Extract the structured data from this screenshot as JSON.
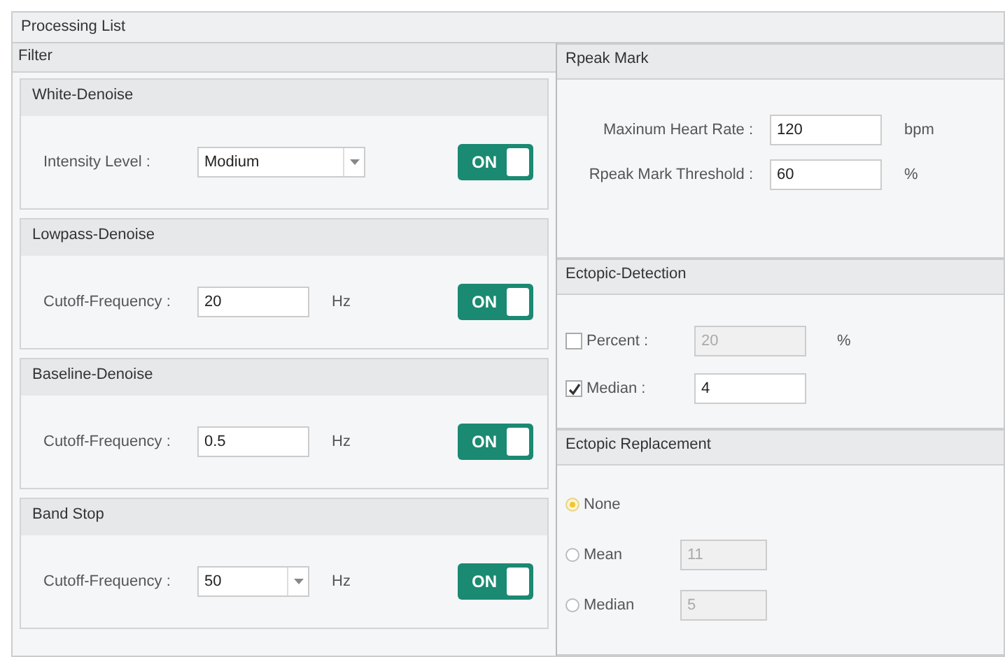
{
  "window": {
    "title": "Processing List"
  },
  "filter": {
    "title": "Filter",
    "sections": [
      {
        "title": "White-Denoise",
        "kind": "select",
        "label": "Intensity Level :",
        "value": "Modium",
        "switch": {
          "label": "ON",
          "on": true
        }
      },
      {
        "title": "Lowpass-Denoise",
        "kind": "input",
        "label": "Cutoff-Frequency :",
        "value": "20",
        "unit": "Hz",
        "switch": {
          "label": "ON",
          "on": true
        }
      },
      {
        "title": "Baseline-Denoise",
        "kind": "input",
        "label": "Cutoff-Frequency :",
        "value": "0.5",
        "unit": "Hz",
        "switch": {
          "label": "ON",
          "on": true
        }
      },
      {
        "title": "Band Stop",
        "kind": "select",
        "label": "Cutoff-Frequency :",
        "value": "50",
        "unit": "Hz",
        "switch": {
          "label": "ON",
          "on": true
        }
      }
    ]
  },
  "rpeak_mark": {
    "title": "Rpeak Mark",
    "fields": [
      {
        "label": "Maxinum Heart Rate :",
        "value": "120",
        "unit": "bpm"
      },
      {
        "label": "Rpeak Mark Threshold :",
        "value": "60",
        "unit": "%"
      }
    ]
  },
  "ectopic_detection": {
    "title": "Ectopic-Detection",
    "options": [
      {
        "label": "Percent :",
        "checked": false,
        "value": "20",
        "unit": "%"
      },
      {
        "label": "Median :",
        "checked": true,
        "value": "4"
      }
    ]
  },
  "ectopic_replacement": {
    "title": "Ectopic Replacement",
    "options": [
      {
        "label": "None",
        "selected": true
      },
      {
        "label": "Mean",
        "selected": false,
        "value": "11"
      },
      {
        "label": "Median",
        "selected": false,
        "value": "5"
      }
    ]
  }
}
